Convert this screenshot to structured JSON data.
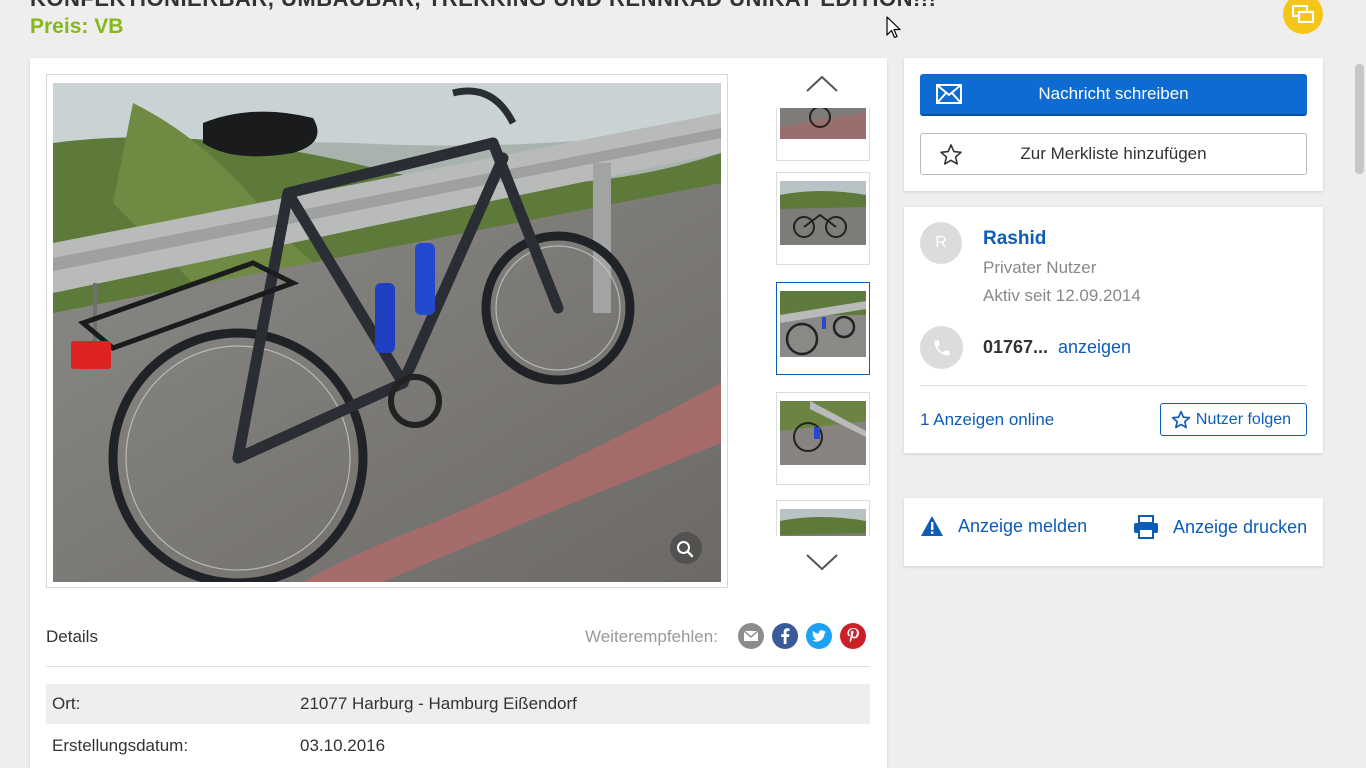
{
  "listing": {
    "title_partial": "KONFEKTIONIERBAR, UMBAUBAR, TREKKING UND RENNRAD UNIKAT EDITION!!!",
    "price": "Preis: VB"
  },
  "gallery": {
    "zoom_icon": "magnifier-icon",
    "up_icon": "chevron-up-icon",
    "down_icon": "chevron-down-icon",
    "thumbnail_count_visible": 5,
    "active_thumbnail_index": 2
  },
  "details": {
    "heading": "Details",
    "share_label": "Weiterempfehlen:",
    "share_icons": [
      "email-icon",
      "facebook-icon",
      "twitter-icon",
      "pinterest-icon"
    ],
    "rows": [
      {
        "key": "Ort:",
        "value": "21077 Harburg - Hamburg Eißendorf"
      },
      {
        "key": "Erstellungsdatum:",
        "value": "03.10.2016"
      }
    ]
  },
  "actions": {
    "message_button": "Nachricht schreiben",
    "watchlist_button": "Zur Merkliste hinzufügen"
  },
  "seller": {
    "initial": "R",
    "name": "Rashid",
    "type": "Privater Nutzer",
    "active_since": "Aktiv seit 12.09.2014",
    "phone_prefix": "01767...",
    "phone_reveal": "anzeigen",
    "ads_online": "1 Anzeigen online",
    "follow_button": "Nutzer folgen"
  },
  "report": {
    "report_label": "Anzeige melden",
    "print_label": "Anzeige drucken"
  },
  "colors": {
    "accent_blue": "#0d6bd1",
    "link_blue": "#0d5db8",
    "price_green": "#86b817",
    "badge_yellow": "#f5c518"
  }
}
